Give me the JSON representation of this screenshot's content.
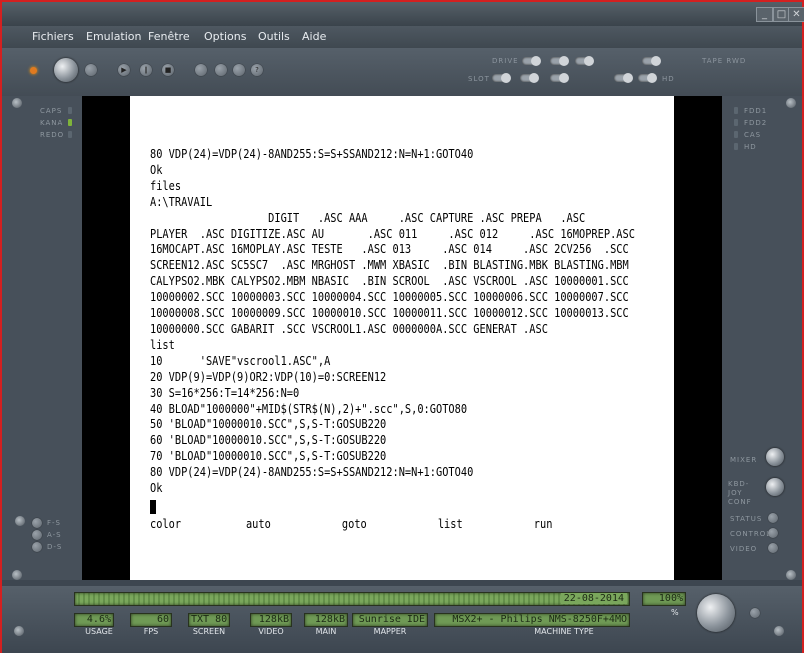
{
  "window": {
    "minimize": "_",
    "maximize": "□",
    "close": "✕"
  },
  "menu": [
    "Fichiers",
    "Emulation",
    "Fenêtre",
    "Options",
    "Outils",
    "Aide"
  ],
  "toolbar_labels": {
    "drive": "DRIVE",
    "slot": "SLOT",
    "tape_rwd": "TAPE RWD",
    "hd": "HD"
  },
  "left_leds": [
    "CAPS",
    "KANA",
    "REDO"
  ],
  "right_leds": [
    "FDD1",
    "FDD2",
    "CAS",
    "HD"
  ],
  "right_controls": [
    "MIXER",
    "KBD-JOY CONF",
    "STATUS",
    "CONTROL",
    "VIDEO"
  ],
  "left_controls": [
    "F-S",
    "A-S",
    "D-S"
  ],
  "screen_lines": [
    "80 VDP(24)=VDP(24)-8AND255:S=S+SSAND212:N=N+1:GOTO40",
    "Ok",
    "files",
    "A:\\TRAVAIL",
    "                   DIGIT   .ASC AAA     .ASC CAPTURE .ASC PREPA   .ASC",
    "PLAYER  .ASC DIGITIZE.ASC AU       .ASC 011     .ASC 012     .ASC 16MOPREP.ASC",
    "16MOCAPT.ASC 16MOPLAY.ASC TESTE   .ASC 013     .ASC 014     .ASC 2CV256  .SCC",
    "SCREEN12.ASC SC5SC7  .ASC MRGHOST .MWM XBASIC  .BIN BLASTING.MBK BLASTING.MBM",
    "CALYPSO2.MBK CALYPSO2.MBM NBASIC  .BIN SCROOL  .ASC VSCROOL .ASC 10000001.SCC",
    "10000002.SCC 10000003.SCC 10000004.SCC 10000005.SCC 10000006.SCC 10000007.SCC",
    "10000008.SCC 10000009.SCC 10000010.SCC 10000011.SCC 10000012.SCC 10000013.SCC",
    "10000000.SCC GABARIT .SCC VSCROOL1.ASC 0000000A.SCC GENERAT .ASC",
    "list",
    "10      'SAVE\"vscrool1.ASC\",A",
    "20 VDP(9)=VDP(9)OR2:VDP(10)=0:SCREEN12",
    "30 S=16*256:T=14*256:N=0",
    "40 BLOAD\"1000000\"+MID$(STR$(N),2)+\".scc\",S,0:GOTO80",
    "50 'BLOAD\"10000010.SCC\",S,S-T:GOSUB220",
    "60 'BLOAD\"10000010.SCC\",S,S-T:GOSUB220",
    "70 'BLOAD\"10000010.SCC\",S,S-T:GOSUB220",
    "80 VDP(24)=VDP(24)-8AND255:S=S+SSAND212:N=N+1:GOTO40",
    "Ok"
  ],
  "function_keys": [
    "color",
    "auto",
    "goto",
    "list",
    "run"
  ],
  "status": {
    "date": "22-08-2014",
    "usage": "4.6%",
    "fps": "60",
    "screen": "TXT 80",
    "video": "128kB",
    "main": "128kB",
    "mapper": "Sunrise IDE",
    "machine": "MSX2+ - Philips NMS-8250F+4MO",
    "volume": "100%"
  },
  "status_labels": {
    "usage": "USAGE",
    "fps": "FPS",
    "screen": "SCREEN",
    "video": "VIDEO",
    "main": "MAIN",
    "mapper": "MAPPER",
    "machine": "MACHINE TYPE",
    "volume_unit": "%"
  }
}
